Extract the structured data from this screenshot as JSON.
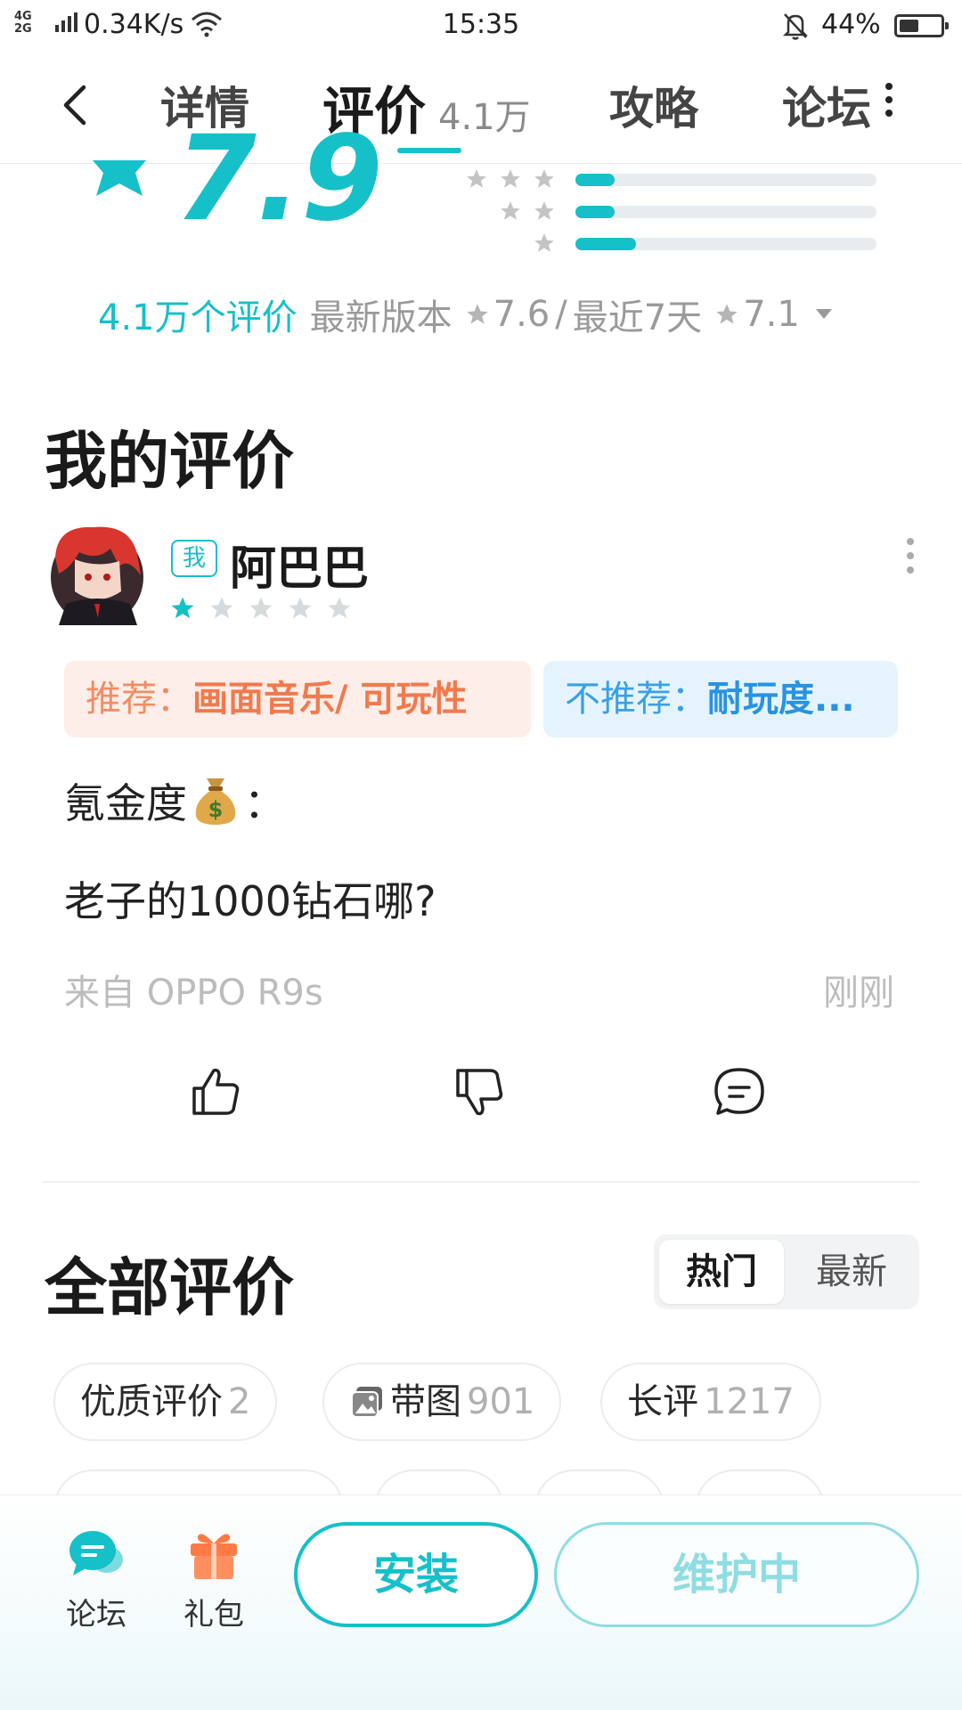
{
  "status_bar": {
    "network_top": "4G",
    "network_bottom": "2G",
    "speed": "0.34K/s",
    "time": "15:35",
    "battery_percent": "44%",
    "battery_level": 0.44
  },
  "header": {
    "tabs": [
      {
        "label": "详情"
      },
      {
        "label": "评价",
        "count": "4.1万"
      },
      {
        "label": "攻略"
      },
      {
        "label": "论坛"
      }
    ],
    "active_tab_index": 1
  },
  "rating": {
    "score": "7.9",
    "distribution": [
      {
        "stars": 3,
        "fraction": 0.13
      },
      {
        "stars": 2,
        "fraction": 0.13
      },
      {
        "stars": 1,
        "fraction": 0.2
      }
    ],
    "count_text": "4.1万个评价",
    "latest_version_label": "最新版本",
    "latest_version_score": "7.6",
    "separator": "/",
    "recent_label": "最近7天",
    "recent_score": "7.1"
  },
  "my_review": {
    "section_title": "我的评价",
    "me_badge": "我",
    "username": "阿巴巴",
    "star_rating": 1,
    "star_max": 5,
    "recommend_label": "推荐：",
    "recommend_value": "画面音乐/ 可玩性",
    "not_recommend_label": "不推荐：",
    "not_recommend_value": "耐玩度...",
    "line1_text": "氪金度",
    "line1_suffix": "：",
    "line2_text": "老子的1000钻石哪?",
    "source": "来自 OPPO R9s",
    "time": "刚刚"
  },
  "all_reviews": {
    "section_title": "全部评价",
    "sort_options": [
      "热门",
      "最新"
    ],
    "active_sort": 0,
    "chips": [
      {
        "label": "优质评价",
        "count": "2"
      },
      {
        "label": "带图",
        "count": "901"
      },
      {
        "label": "长评",
        "count": "1217"
      }
    ]
  },
  "bottom_bar": {
    "forum_label": "论坛",
    "gift_label": "礼包",
    "install_label": "安装",
    "maintenance_label": "维护中"
  },
  "colors": {
    "accent": "#16c0c8",
    "recommend": "#f07a4e",
    "not_recommend": "#2893e0",
    "gift": "#ff7a45"
  }
}
